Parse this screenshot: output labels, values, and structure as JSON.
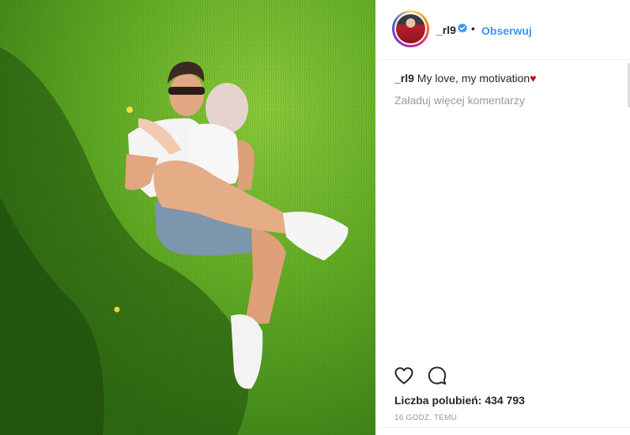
{
  "post": {
    "username": "_rl9",
    "separator": "•",
    "follow_label": "Obserwuj",
    "caption_user": "_rl9",
    "caption_text": " My love, my motivation",
    "caption_emoji": "♥",
    "load_more_label": "Załaduj więcej komentarzy",
    "likes_label": "Liczba polubień: 434 793",
    "time_label": "16 GODZ. TEMU"
  },
  "icons": {
    "verified": "verified-badge-icon",
    "like": "heart-outline-icon",
    "comment": "comment-bubble-icon"
  },
  "colors": {
    "accent": "#3897f0",
    "text": "#262626",
    "muted": "#999999",
    "grass": "#4f9a1f",
    "heart_emoji": "#c1121f"
  }
}
